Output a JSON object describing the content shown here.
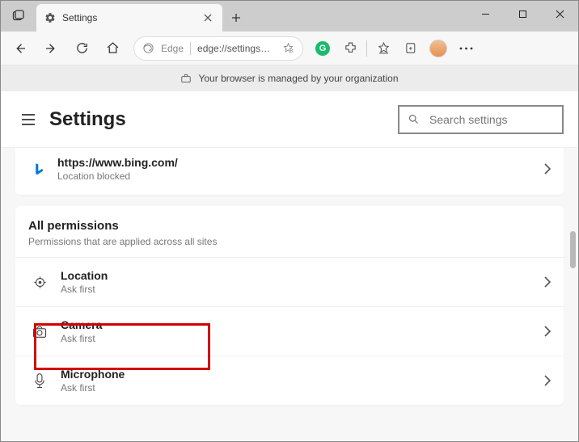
{
  "tab": {
    "title": "Settings"
  },
  "address": {
    "engine": "Edge",
    "url": "edge://settings…"
  },
  "infobar": {
    "message": "Your browser is managed by your organization"
  },
  "header": {
    "title": "Settings",
    "search_placeholder": "Search settings"
  },
  "recent_site": {
    "url": "https://www.bing.com/",
    "status": "Location blocked"
  },
  "all_permissions": {
    "title": "All permissions",
    "subtitle": "Permissions that are applied across all sites",
    "items": [
      {
        "label": "Location",
        "status": "Ask first"
      },
      {
        "label": "Camera",
        "status": "Ask first"
      },
      {
        "label": "Microphone",
        "status": "Ask first"
      }
    ]
  }
}
